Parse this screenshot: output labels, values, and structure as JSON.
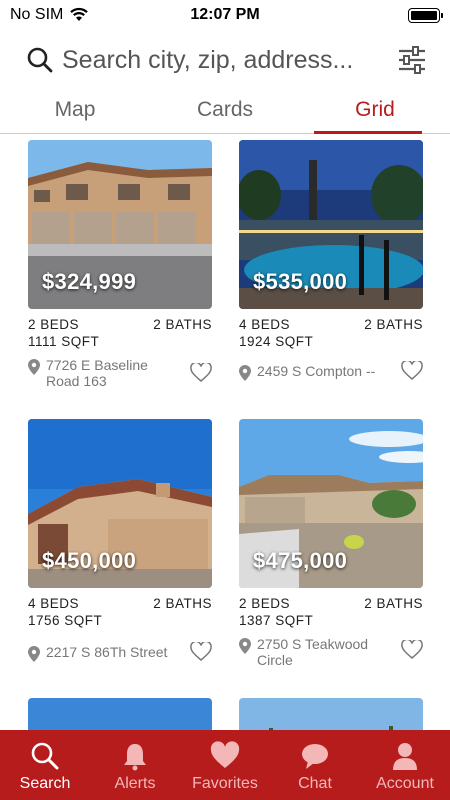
{
  "status_bar": {
    "carrier": "No SIM",
    "time": "12:07 PM"
  },
  "search": {
    "placeholder": "Search city, zip, address..."
  },
  "tabs": [
    {
      "label": "Map",
      "active": false
    },
    {
      "label": "Cards",
      "active": false
    },
    {
      "label": "Grid",
      "active": true
    }
  ],
  "listings": [
    {
      "price": "$324,999",
      "beds": "2 BEDS",
      "baths": "2 BATHS",
      "sqft": "1111 SQFT",
      "address": "7726 E Baseline Road 163"
    },
    {
      "price": "$535,000",
      "beds": "4 BEDS",
      "baths": "2 BATHS",
      "sqft": "1924 SQFT",
      "address": "2459 S Compton --"
    },
    {
      "price": "$450,000",
      "beds": "4 BEDS",
      "baths": "2 BATHS",
      "sqft": "1756 SQFT",
      "address": "2217 S 86Th Street"
    },
    {
      "price": "$475,000",
      "beds": "2 BEDS",
      "baths": "2 BATHS",
      "sqft": "1387 SQFT",
      "address": "2750 S Teakwood Circle"
    }
  ],
  "bottom_nav": [
    {
      "label": "Search",
      "icon": "search-icon",
      "active": true
    },
    {
      "label": "Alerts",
      "icon": "bell-icon",
      "active": false
    },
    {
      "label": "Favorites",
      "icon": "heart-icon",
      "active": false
    },
    {
      "label": "Chat",
      "icon": "chat-bubble-icon",
      "active": false
    },
    {
      "label": "Account",
      "icon": "person-icon",
      "active": false
    }
  ],
  "colors": {
    "accent": "#b71c1c",
    "nav_inactive_text": "#f3b7b7",
    "muted_text": "#777777"
  }
}
